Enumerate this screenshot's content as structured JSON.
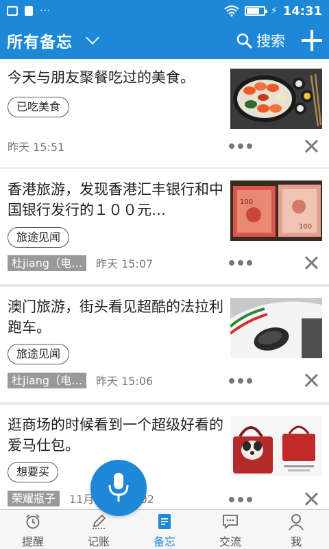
{
  "status_bar": {
    "time": "14:31"
  },
  "header": {
    "title": "所有备忘",
    "search_label": "搜索"
  },
  "notes": [
    {
      "text": "今天与朋友聚餐吃过的美食。",
      "tag": "已吃美食",
      "author": "",
      "time": "昨天 15:51"
    },
    {
      "text": "香港旅游，发现香港汇丰银行和中国银行发行的１００元…",
      "tag": "旅途见闻",
      "author": "杜jiang（电…",
      "time": "昨天 15:07"
    },
    {
      "text": "澳门旅游，街头看见超酷的法拉利跑车。",
      "tag": "旅途见闻",
      "author": "杜jiang（电…",
      "time": "昨天 15:06"
    },
    {
      "text": "逛商场的时候看到一个超级好看的爱马仕包。",
      "tag": "想要买",
      "author": "荣耀瓶子",
      "time": "11月19日 17:02"
    }
  ],
  "bottom_nav": [
    {
      "label": "提醒",
      "icon": "alarm-clock-icon"
    },
    {
      "label": "记账",
      "icon": "pen-icon"
    },
    {
      "label": "备忘",
      "icon": "document-icon"
    },
    {
      "label": "交流",
      "icon": "chat-bubble-icon"
    },
    {
      "label": "我",
      "icon": "person-icon"
    }
  ],
  "colors": {
    "primary": "#1e88d8",
    "background": "#e9e9e9",
    "card": "#ffffff",
    "muted_text": "#777777"
  }
}
